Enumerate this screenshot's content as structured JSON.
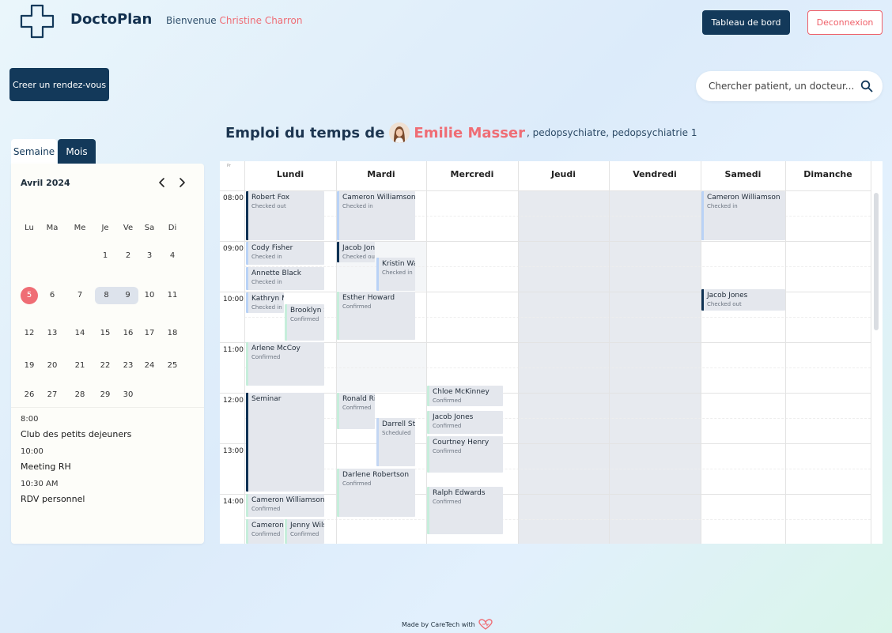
{
  "header": {
    "app_name": "DoctoPlan",
    "welcome_prefix": "Bienvenue",
    "user_name": "Christine Charron",
    "dashboard_label": "Tableau de bord",
    "logout_label": "Deconnexion"
  },
  "toolbar": {
    "create_label": "Creer un rendez-vous",
    "search_placeholder": "Chercher patient, un docteur..."
  },
  "tabs": {
    "week": "Semaine",
    "month": "Mois"
  },
  "mini_calendar": {
    "title": "Avril 2024",
    "weekdays": [
      "Lu",
      "Ma",
      "Me",
      "Je",
      "Ve",
      "Sa",
      "Di"
    ],
    "weeks": [
      [
        "",
        "",
        "",
        "1",
        "2",
        "3",
        "4"
      ],
      [
        "5",
        "6",
        "7",
        "8",
        "9",
        "10",
        "11"
      ],
      [
        "12",
        "13",
        "14",
        "15",
        "16",
        "17",
        "18"
      ],
      [
        "19",
        "20",
        "21",
        "22",
        "23",
        "24",
        "25"
      ],
      [
        "26",
        "27",
        "28",
        "29",
        "30",
        "",
        ""
      ]
    ],
    "today": "5",
    "highlighted": [
      "8",
      "9"
    ]
  },
  "events": [
    {
      "time": "8:00",
      "title": "Club des petits dejeuners"
    },
    {
      "time": "10:00",
      "title": "Meeting RH"
    },
    {
      "time": "10:30 AM",
      "title": "RDV personnel"
    }
  ],
  "schedule": {
    "heading_prefix": "Emploi du temps de",
    "doctor_name": "Emilie Masser",
    "doctor_details": ", pedopsychiatre, pedopsychiatrie 1",
    "corner_label": "Pr",
    "days": [
      "Lundi",
      "Mardi",
      "Mercredi",
      "Jeudi",
      "Vendredi",
      "Samedi",
      "Dimanche"
    ],
    "hours": [
      "08:00",
      "09:00",
      "10:00",
      "11:00",
      "12:00",
      "13:00",
      "14:00"
    ],
    "appointments": [
      {
        "name": "Robert Fox",
        "status": "Checked out",
        "kind": "s-out"
      },
      {
        "name": "Cody Fisher",
        "status": "Checked in",
        "kind": "s-checkin"
      },
      {
        "name": "Annette Black",
        "status": "Checked in",
        "kind": "s-checkin"
      },
      {
        "name": "Kathryn Murphy",
        "status": "Checked in",
        "kind": "s-checkin"
      },
      {
        "name": "Brooklyn Simmons",
        "status": "Confirmed",
        "kind": "s-confirm"
      },
      {
        "name": "Arlene McCoy",
        "status": "Confirmed",
        "kind": "s-confirm"
      },
      {
        "name": "Seminar",
        "status": "",
        "kind": "s-out"
      },
      {
        "name": "Cameron Williamson",
        "status": "Confirmed",
        "kind": "s-confirm"
      },
      {
        "name": "Cameron Williamson",
        "status": "Confirmed",
        "kind": "s-confirm"
      },
      {
        "name": "Jenny Wilson",
        "status": "Confirmed",
        "kind": "s-confirm"
      },
      {
        "name": "Cameron Williamson",
        "status": "Checked in",
        "kind": "s-checkin"
      },
      {
        "name": "Jacob Jones",
        "status": "Checked out",
        "kind": "s-out"
      },
      {
        "name": "Kristin Watson",
        "status": "Checked in",
        "kind": "s-checkin"
      },
      {
        "name": "Esther Howard",
        "status": "Confirmed",
        "kind": "s-confirm"
      },
      {
        "name": "Ronald Richards",
        "status": "Confirmed",
        "kind": "s-confirm"
      },
      {
        "name": "Darrell Steward",
        "status": "Scheduled",
        "kind": "s-sched"
      },
      {
        "name": "Darlene Robertson",
        "status": "Confirmed",
        "kind": "s-confirm"
      },
      {
        "name": "Chloe McKinney",
        "status": "Confirmed",
        "kind": "s-confirm"
      },
      {
        "name": "Jacob Jones",
        "status": "Confirmed",
        "kind": "s-confirm"
      },
      {
        "name": "Courtney Henry",
        "status": "Confirmed",
        "kind": "s-confirm"
      },
      {
        "name": "Ralph Edwards",
        "status": "Confirmed",
        "kind": "s-confirm"
      },
      {
        "name": "Cameron Williamson",
        "status": "Checked in",
        "kind": "s-checkin"
      },
      {
        "name": "Jacob Jones",
        "status": "Checked out",
        "kind": "s-out"
      }
    ]
  },
  "footer": {
    "text": "Made by CareTech with"
  },
  "colors": {
    "primary": "#13395a",
    "accent": "#ef6d75",
    "logout": "#ef5f68"
  }
}
